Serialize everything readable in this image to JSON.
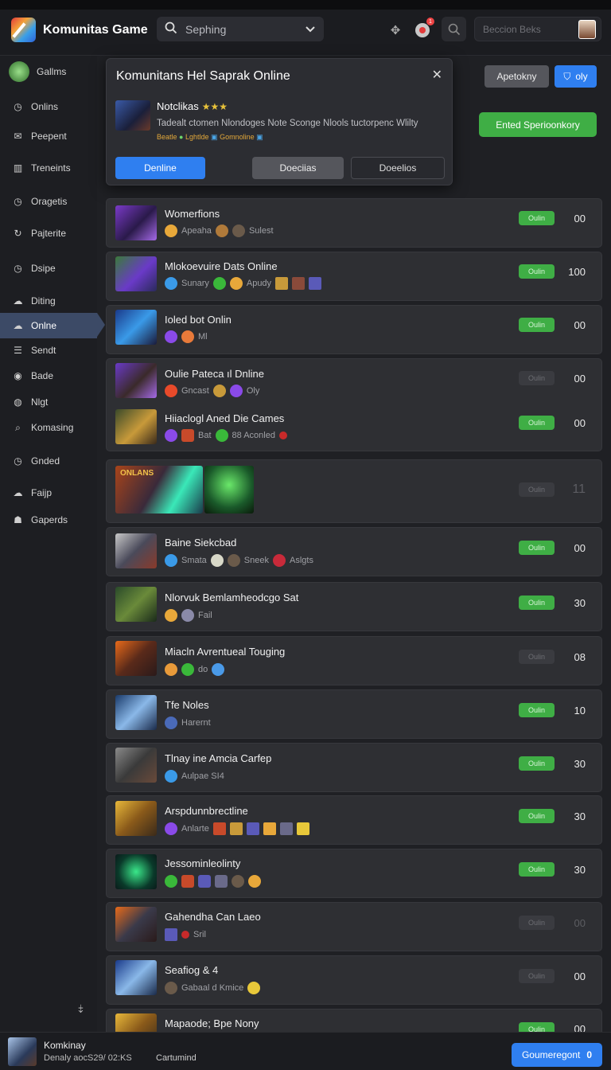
{
  "app": {
    "title": "Komunitas Game"
  },
  "search": {
    "value": "Sephing"
  },
  "profile": {
    "placeholder": "Beccion Beks"
  },
  "sidebar": {
    "items": [
      {
        "label": "Gallms",
        "icon": "avatar"
      },
      {
        "label": "Onlins",
        "icon": "clock-icon"
      },
      {
        "label": "Peepent",
        "icon": "mail-icon"
      },
      {
        "label": "Treneints",
        "icon": "stats-icon"
      },
      {
        "label": "Oragetis",
        "icon": "clock-icon"
      },
      {
        "label": "Pajterite",
        "icon": "refresh-icon"
      },
      {
        "label": "Dsipe",
        "icon": "clock-icon"
      },
      {
        "label": "Diting",
        "icon": "cloud-icon"
      },
      {
        "label": "Onlne",
        "icon": "cloud-icon"
      },
      {
        "label": "Sendt",
        "icon": "list-icon"
      },
      {
        "label": "Bade",
        "icon": "eye-icon"
      },
      {
        "label": "Nlgt",
        "icon": "globe-icon"
      },
      {
        "label": "Komasing",
        "icon": "search-icon"
      },
      {
        "label": "Gnded",
        "icon": "clock-icon"
      },
      {
        "label": "Faijp",
        "icon": "cloud-icon"
      },
      {
        "label": "Gaperds",
        "icon": "people-icon"
      }
    ]
  },
  "popup": {
    "title": "Komunitans Hel Saprak Online",
    "name": "Notclikas",
    "stars": "★★★",
    "description": "Tadealt ctomen Nlondoges Note Sconge Nlools tuctorpenc Wlilty",
    "tag1": "Beatle",
    "tag2": "Lghtlde",
    "tag3": "Gomnoline",
    "btn_primary": "Denline",
    "btn_secondary": "Doeciias",
    "btn_tertiary": "Doeelios"
  },
  "header_actions": {
    "btn1": "Apetokny",
    "btn2": "oly",
    "cta": "Ented Sperioonkory"
  },
  "games": [
    {
      "title": "Womerfions",
      "sub": [
        "Apeaha",
        "Sulest"
      ],
      "status": "Oulin",
      "online": true,
      "count": "00"
    },
    {
      "title": "Mlokoevuire Dats Online",
      "sub": [
        "Sunary",
        "Apudy"
      ],
      "status": "Oulin",
      "online": true,
      "count": "100"
    },
    {
      "title": "Ioled bot Onlin",
      "sub": [
        "Ml"
      ],
      "status": "Oulin",
      "online": true,
      "count": "00"
    },
    {
      "title": "Oulie Pateca ıl Dnline",
      "sub": [
        "Gncast",
        "Oly"
      ],
      "status": "Oulin",
      "online": false,
      "count": "00"
    },
    {
      "title": "Hiiaclogl Aned Die Cames",
      "sub": [
        "Bat",
        "88 Aconled"
      ],
      "status": "Oulin",
      "online": true,
      "count": "00"
    },
    {
      "title": "",
      "sub": [],
      "banner": "ONLANS",
      "status": "Oulin",
      "online": false,
      "count": "11"
    },
    {
      "title": "Baine Siekcbad",
      "sub": [
        "Smata",
        "Sneek",
        "Aslgts"
      ],
      "status": "Oulin",
      "online": true,
      "count": "00"
    },
    {
      "title": "Nlorvuk Bemlamheodcgo Sat",
      "sub": [
        "Fail"
      ],
      "status": "Oulin",
      "online": true,
      "count": "30"
    },
    {
      "title": "Miacln Avrentueal Touging",
      "sub": [
        "do"
      ],
      "status": "Oulin",
      "online": false,
      "count": "08"
    },
    {
      "title": "Tfe Noles",
      "sub": [
        "Harernt"
      ],
      "status": "Oulin",
      "online": true,
      "count": "10"
    },
    {
      "title": "Tlnay ine Amcia Carfep",
      "sub": [
        "Aulpae SI4"
      ],
      "status": "Oulin",
      "online": true,
      "count": "30"
    },
    {
      "title": "Arspdunnbrectline",
      "sub": [
        "Anlarte"
      ],
      "status": "Oulin",
      "online": true,
      "count": "30"
    },
    {
      "title": "Jessominleolinty",
      "sub": [],
      "status": "Oulin",
      "online": true,
      "count": "30"
    },
    {
      "title": "Gahendha Can Laeo",
      "sub": [
        "Sril"
      ],
      "status": "Oulin",
      "online": false,
      "count": "00"
    },
    {
      "title": "Seafiog & 4",
      "sub": [
        "Gabaal d Kmice"
      ],
      "status": "Oulin",
      "online": false,
      "count": "00"
    },
    {
      "title": "Mapaode; Bpe Nony",
      "sub": [],
      "status": "Oulin",
      "online": true,
      "count": "00"
    }
  ],
  "footer": {
    "name": "Komkinay",
    "status": "Denaly aocS29/ 02:KS",
    "status2": "Cartumind",
    "button": "Goumeregont",
    "button_count": "0"
  },
  "colors": {
    "accent_blue": "#2f7ff0",
    "accent_green": "#3fae45",
    "bg": "#1f2024"
  }
}
